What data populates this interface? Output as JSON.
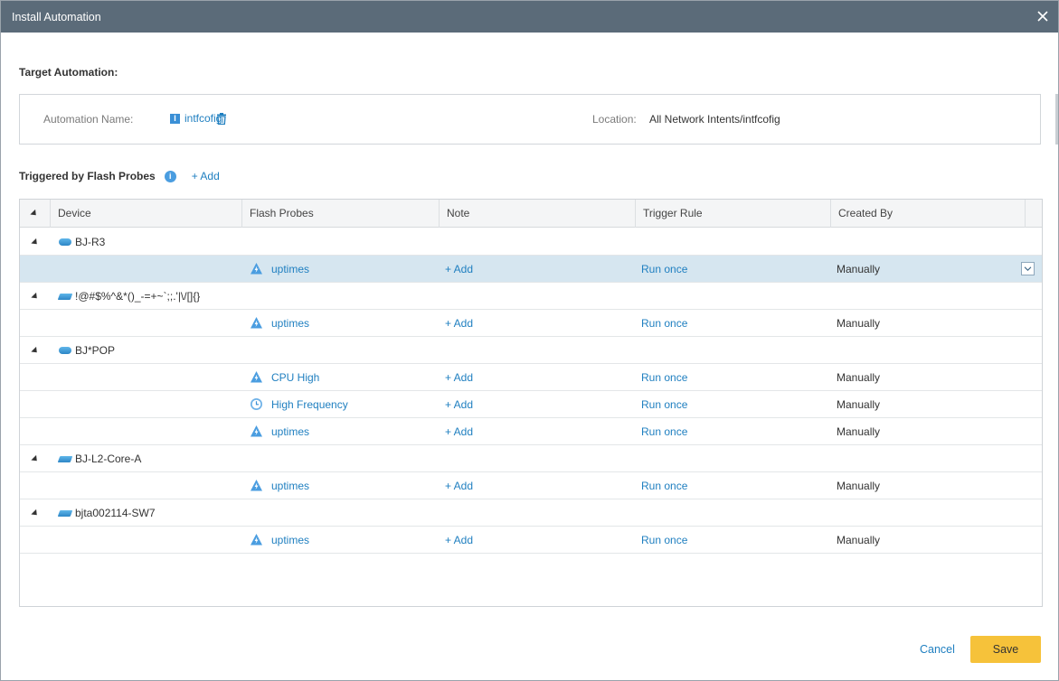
{
  "dialog": {
    "title": "Install Automation",
    "close_icon": "close-icon"
  },
  "target": {
    "section_label": "Target Automation:",
    "name_label": "Automation Name:",
    "name_badge": "I",
    "name_value": "intfcofig",
    "location_label": "Location:",
    "location_value": "All Network Intents/intfcofig"
  },
  "triggered": {
    "section_label": "Triggered by Flash Probes",
    "info_glyph": "i",
    "add_label": "+ Add"
  },
  "grid": {
    "columns": [
      "Device",
      "Flash Probes",
      "Note",
      "Trigger Rule",
      "Created By"
    ],
    "rows": [
      {
        "kind": "device",
        "name": "BJ-R3",
        "icon": "router-icon"
      },
      {
        "kind": "probe",
        "probe": "uptimes",
        "icon": "flash-probe-icon",
        "note": "+ Add",
        "rule": "Run once",
        "created_by": "Manually",
        "selected": true
      },
      {
        "kind": "device",
        "name": "!@#$%^&*()_-=+~`;;.'|\\/[]{}",
        "icon": "switch-icon"
      },
      {
        "kind": "probe",
        "probe": "uptimes",
        "icon": "flash-probe-icon",
        "note": "+ Add",
        "rule": "Run once",
        "created_by": "Manually"
      },
      {
        "kind": "device",
        "name": "BJ*POP",
        "icon": "router-icon"
      },
      {
        "kind": "probe",
        "probe": "CPU High",
        "icon": "flash-probe-icon",
        "note": "+ Add",
        "rule": "Run once",
        "created_by": "Manually"
      },
      {
        "kind": "probe",
        "probe": "High Frequency",
        "icon": "clock-icon",
        "note": "+ Add",
        "rule": "Run once",
        "created_by": "Manually"
      },
      {
        "kind": "probe",
        "probe": "uptimes",
        "icon": "flash-probe-icon",
        "note": "+ Add",
        "rule": "Run once",
        "created_by": "Manually"
      },
      {
        "kind": "device",
        "name": "BJ-L2-Core-A",
        "icon": "switch-icon"
      },
      {
        "kind": "probe",
        "probe": "uptimes",
        "icon": "flash-probe-icon",
        "note": "+ Add",
        "rule": "Run once",
        "created_by": "Manually"
      },
      {
        "kind": "device",
        "name": "bjta002114-SW7",
        "icon": "switch-icon"
      },
      {
        "kind": "probe",
        "probe": "uptimes",
        "icon": "flash-probe-icon",
        "note": "+ Add",
        "rule": "Run once",
        "created_by": "Manually"
      }
    ]
  },
  "footer": {
    "cancel_label": "Cancel",
    "save_label": "Save"
  },
  "colors": {
    "titlebar": "#5b6b79",
    "link": "#1f7fc0",
    "save": "#f6c23a",
    "selected_row": "#d6e6f0"
  }
}
